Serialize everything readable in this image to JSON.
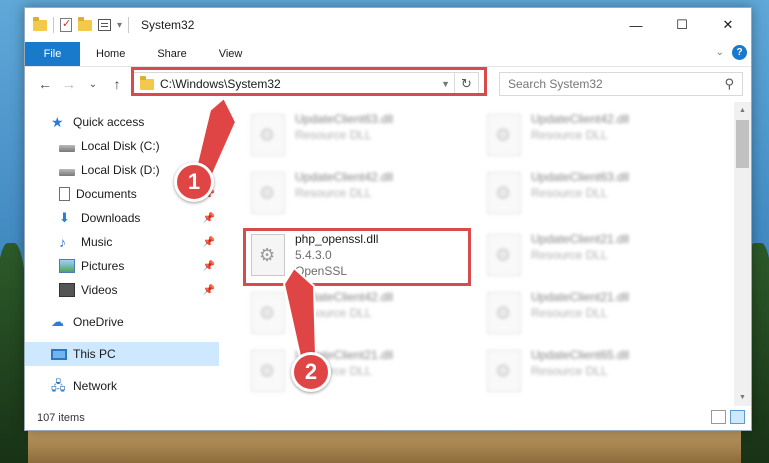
{
  "window": {
    "title": "System32",
    "controls": {
      "minimize": "—",
      "maximize": "☐",
      "close": "✕"
    }
  },
  "ribbon": {
    "file_tab": "File",
    "tabs": [
      "Home",
      "Share",
      "View"
    ],
    "help_icon": "?"
  },
  "nav": {
    "back_icon": "←",
    "forward_icon": "→",
    "recent_icon": "⌄",
    "up_icon": "↑",
    "address_path": "C:\\Windows\\System32",
    "refresh_icon": "↻",
    "search_placeholder": "Search System32",
    "search_icon": "⚲"
  },
  "sidebar": {
    "quick_access": "Quick access",
    "items": [
      {
        "label": "Local Disk (C:)",
        "pinned": true
      },
      {
        "label": "Local Disk (D:)",
        "pinned": true
      },
      {
        "label": "Documents",
        "pinned": true
      },
      {
        "label": "Downloads",
        "pinned": true
      },
      {
        "label": "Music",
        "pinned": true
      },
      {
        "label": "Pictures",
        "pinned": true
      },
      {
        "label": "Videos",
        "pinned": true
      }
    ],
    "onedrive": "OneDrive",
    "this_pc": "This PC",
    "network": "Network"
  },
  "files": {
    "highlighted": {
      "name": "php_openssl.dll",
      "version": "5.4.3.0",
      "description": "OpenSSL"
    },
    "background": [
      {
        "name": "UpdateClient63.dll",
        "type": "Resource DLL"
      },
      {
        "name": "UpdateClient42.dll",
        "type": "Resource DLL"
      },
      {
        "name": "UpdateClient42.dll",
        "type": "Resource DLL"
      },
      {
        "name": "UpdateClient63.dll",
        "type": "Resource DLL"
      },
      {
        "name": "UpdateClient21.dll",
        "type": "Resource DLL"
      },
      {
        "name": "UpdateClient42.dll",
        "type": "Resource DLL"
      },
      {
        "name": "UpdateClient21.dll",
        "type": "Resource DLL"
      },
      {
        "name": "UpdateClient21.dll",
        "type": "Resource DLL"
      },
      {
        "name": "UpdateClient65.dll",
        "type": "Resource DLL"
      }
    ]
  },
  "status": {
    "item_count": "107 items"
  },
  "annotations": {
    "step1": "1",
    "step2": "2",
    "color": "#d94b4b"
  }
}
